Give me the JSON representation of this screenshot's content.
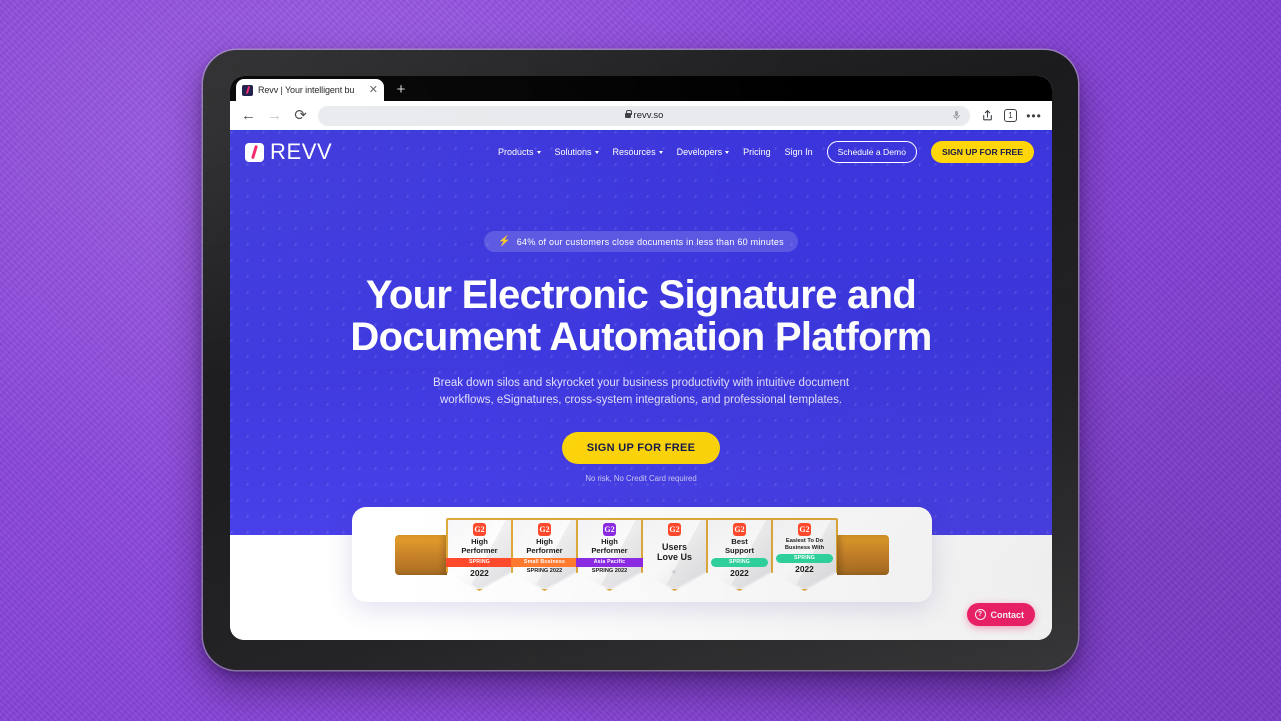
{
  "browser": {
    "tab": {
      "title": "Revv | Your intelligent bu",
      "close_icon": "close-icon",
      "favicon": "revv-favicon"
    },
    "new_tab_label": "+",
    "back_icon": "←",
    "forward_icon": "→",
    "reload_icon": "⟳",
    "url": "revv.so",
    "mic_icon": "microphone-icon",
    "share_icon": "⇧",
    "tab_count": "1",
    "more_icon": "•••"
  },
  "site": {
    "logo_text": "REVV",
    "nav": [
      {
        "label": "Products",
        "has_caret": true
      },
      {
        "label": "Solutions",
        "has_caret": true
      },
      {
        "label": "Resources",
        "has_caret": true
      },
      {
        "label": "Developers",
        "has_caret": true
      },
      {
        "label": "Pricing",
        "has_caret": false
      },
      {
        "label": "Sign In",
        "has_caret": false
      }
    ],
    "demo_button": "Schedule a Demo",
    "signup_button": "SIGN UP FOR FREE"
  },
  "hero": {
    "badge_icon": "⚡",
    "badge_text": "64% of our customers close documents in less than 60 minutes",
    "headline_line1": "Your Electronic Signature and",
    "headline_line2": "Document Automation Platform",
    "subheading_line1": "Break down silos and skyrocket your business productivity with intuitive document",
    "subheading_line2": "workflows, eSignatures, cross-system integrations, and professional templates.",
    "cta_label": "SIGN UP FOR FREE",
    "disclaimer": "No risk, No Credit Card required",
    "bg_color": "#3b35db",
    "accent_color": "#ffd60a"
  },
  "badges": [
    {
      "logo": "G2",
      "logo_color": "#ff492c",
      "title_line1": "High",
      "title_line2": "Performer",
      "band": "SPRING",
      "band_color": "#ff492c",
      "band_rounded": false,
      "year": "2022",
      "year_small": false,
      "small_title": false
    },
    {
      "logo": "G2",
      "logo_color": "#ff492c",
      "title_line1": "High",
      "title_line2": "Performer",
      "band": "Small Business",
      "band_color": "#ff7a2f",
      "band_rounded": false,
      "year": "SPRING 2022",
      "year_small": true,
      "small_title": false
    },
    {
      "logo": "G2",
      "logo_color": "#8a2be2",
      "title_line1": "High",
      "title_line2": "Performer",
      "band": "Asia Pacific",
      "band_color": "#8a2be2",
      "band_rounded": false,
      "year": "SPRING 2022",
      "year_small": true,
      "small_title": false
    },
    {
      "logo": "G2",
      "logo_color": "#ff492c",
      "title_line1": "Users",
      "title_line2": "Love Us",
      "band": "",
      "band_color": "",
      "band_rounded": false,
      "year": "",
      "year_small": false,
      "small_title": false
    },
    {
      "logo": "G2",
      "logo_color": "#ff492c",
      "title_line1": "Best",
      "title_line2": "Support",
      "band": "SPRING",
      "band_color": "#2ecf9b",
      "band_rounded": true,
      "year": "2022",
      "year_small": false,
      "small_title": false
    },
    {
      "logo": "G2",
      "logo_color": "#ff492c",
      "title_line1": "Easiest To Do",
      "title_line2": "Business With",
      "band": "SPRING",
      "band_color": "#2ecf9b",
      "band_rounded": true,
      "year": "2022",
      "year_small": false,
      "small_title": true
    }
  ],
  "widget": {
    "label": "Contact",
    "icon": "?",
    "color": "#f5226b"
  }
}
